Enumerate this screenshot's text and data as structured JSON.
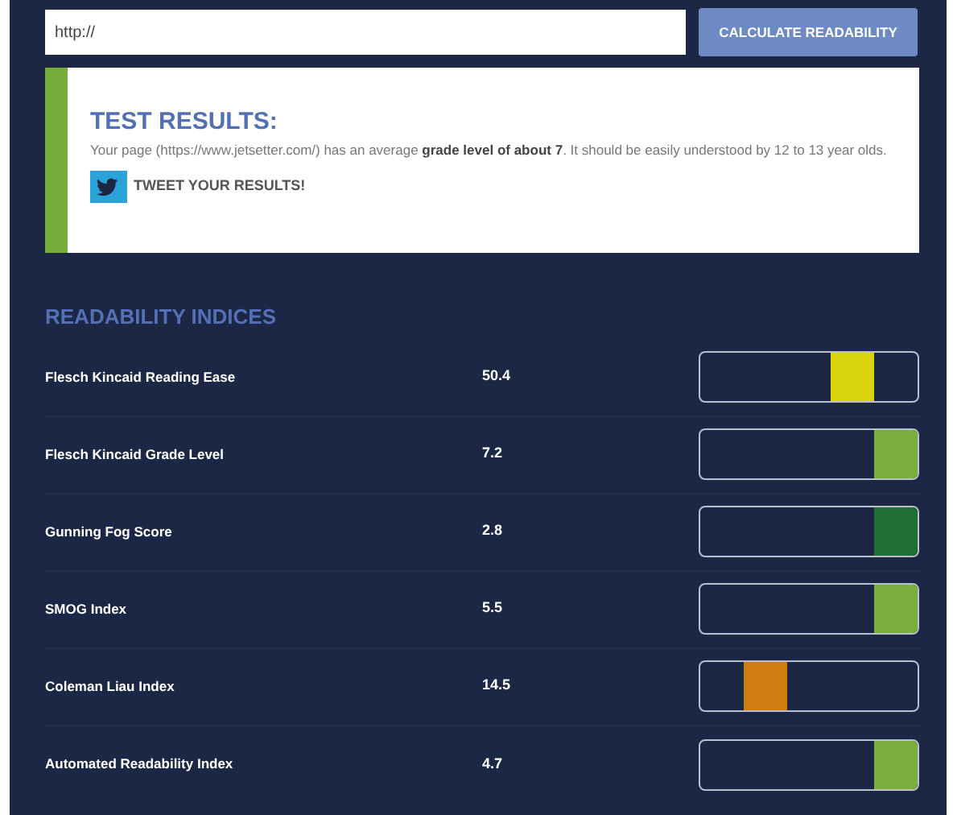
{
  "url_field": {
    "value": "http://"
  },
  "calculate_button": "CALCULATE READABILITY",
  "results": {
    "title": "TEST RESULTS:",
    "text": "Your page (https://www.jetsetter.com/) has an average **grade level of about 7**. It should be easily understood by 12 to 13 year olds.",
    "tweet_button": "TWEET YOUR RESULTS!"
  },
  "indices_title": "READABILITY INDICES",
  "indices": [
    {
      "name": "Flesch Kincaid Reading Ease",
      "value": "50.4",
      "kind": "mid",
      "color": "#d8d30c"
    },
    {
      "name": "Flesch Kincaid Grade Level",
      "value": "7.2",
      "kind": "high",
      "color": "#7aae3e"
    },
    {
      "name": "Gunning Fog Score",
      "value": "2.8",
      "kind": "high",
      "color": "#1f6f33"
    },
    {
      "name": "SMOG Index",
      "value": "5.5",
      "kind": "high",
      "color": "#7aae3e"
    },
    {
      "name": "Coleman Liau Index",
      "value": "14.5",
      "kind": "low",
      "color": "#cf7c12"
    },
    {
      "name": "Automated Readability Index",
      "value": "4.7",
      "kind": "high",
      "color": "#7aae3e"
    }
  ]
}
